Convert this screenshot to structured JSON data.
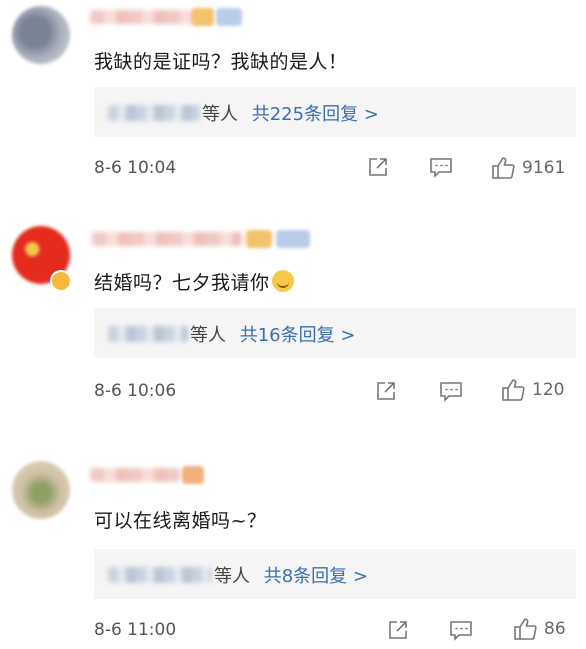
{
  "comments": [
    {
      "text": "我缺的是证吗？我缺的是人！",
      "reply_suffix": "等人",
      "reply_link": "共225条回复 >",
      "time": "8-6 10:04",
      "likes": "9161"
    },
    {
      "text": "结婚吗？七夕我请你",
      "reply_suffix": "等人",
      "reply_link": "共16条回复 >",
      "time": "8-6 10:06",
      "likes": "120"
    },
    {
      "text": "可以在线离婚吗~？",
      "reply_suffix": "等人",
      "reply_link": "共8条回复 >",
      "time": "8-6 11:00",
      "likes": "86"
    }
  ],
  "icons": {
    "share": "share-icon",
    "comment": "comment-icon",
    "like": "thumbs-up-icon"
  },
  "colors": {
    "link": "#3a6fb0",
    "reply_bg": "#f5f5f5"
  }
}
